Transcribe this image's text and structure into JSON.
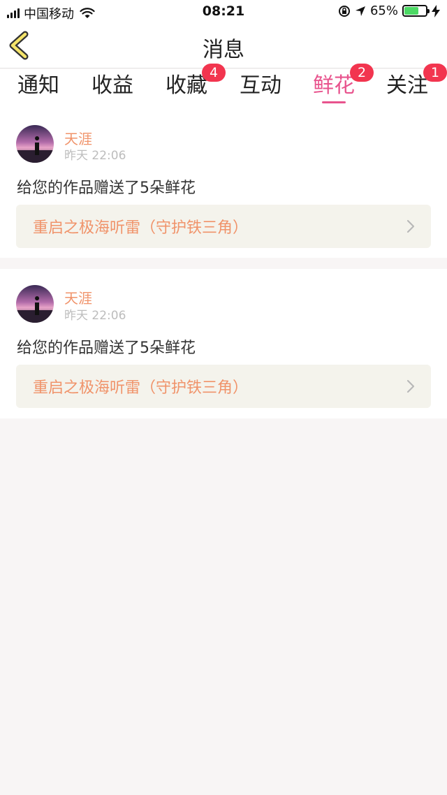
{
  "status_bar": {
    "carrier": "中国移动",
    "time": "08:21",
    "battery_percent": "65%",
    "battery_level": 0.65,
    "battery_color": "#4cd964"
  },
  "nav": {
    "title": "消息",
    "back_icon": "chevron-left-icon"
  },
  "tabs": [
    {
      "label": "通知",
      "badge": ""
    },
    {
      "label": "收益",
      "badge": ""
    },
    {
      "label": "收藏",
      "badge": "4"
    },
    {
      "label": "互动",
      "badge": ""
    },
    {
      "label": "鲜花",
      "badge": "2",
      "active": true
    },
    {
      "label": "关注",
      "badge": "1"
    }
  ],
  "messages": [
    {
      "user_name": "天涯",
      "time": "昨天 22:06",
      "text": "给您的作品赠送了5朵鲜花",
      "work_title": "重启之极海听雷（守护铁三角）"
    },
    {
      "user_name": "天涯",
      "time": "昨天 22:06",
      "text": "给您的作品赠送了5朵鲜花",
      "work_title": "重启之极海听雷（守护铁三角）"
    }
  ],
  "colors": {
    "accent": "#e8538d",
    "badge": "#f2354f",
    "username": "#f0936a",
    "background": "#f8f5f5"
  }
}
